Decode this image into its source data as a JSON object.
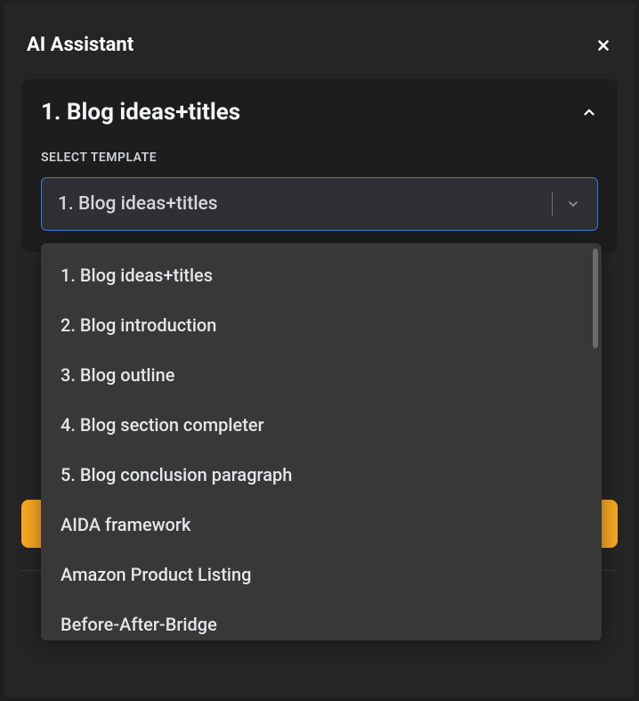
{
  "header": {
    "title": "AI Assistant"
  },
  "card": {
    "title": "1. Blog ideas+titles",
    "field_label": "SELECT TEMPLATE",
    "selected_value": "1. Blog ideas+titles"
  },
  "dropdown": {
    "options": [
      "1. Blog ideas+titles",
      "2. Blog introduction",
      "3. Blog outline",
      "4. Blog section completer",
      "5. Blog conclusion paragraph",
      "AIDA framework",
      "Amazon Product Listing",
      "Before-After-Bridge"
    ]
  }
}
